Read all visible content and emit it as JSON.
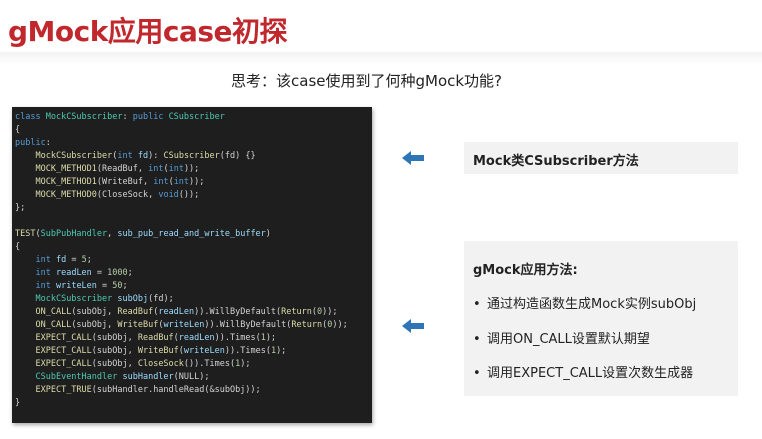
{
  "slide": {
    "title": "gMock应用case初探",
    "question": "思考：该case使用到了何种gMock功能?"
  },
  "code": {
    "lines": [
      [
        [
          "kw",
          "class "
        ],
        [
          "ty",
          "MockCSubscriber"
        ],
        [
          "t",
          ": "
        ],
        [
          "kw",
          "public "
        ],
        [
          "ty",
          "CSubscriber"
        ]
      ],
      [
        [
          "t",
          "{"
        ]
      ],
      [
        [
          "kw",
          "public"
        ],
        [
          "t",
          ":"
        ]
      ],
      [
        [
          "t",
          "    "
        ],
        [
          "fn",
          "MockCSubscriber"
        ],
        [
          "t",
          "("
        ],
        [
          "kw",
          "int "
        ],
        [
          "vr",
          "fd"
        ],
        [
          "t",
          "): "
        ],
        [
          "fn",
          "CSubscriber"
        ],
        [
          "t",
          "(fd) {}"
        ]
      ],
      [
        [
          "t",
          "    "
        ],
        [
          "fn",
          "MOCK_METHOD1"
        ],
        [
          "t",
          "(ReadBuf, "
        ],
        [
          "kw",
          "int"
        ],
        [
          "t",
          "("
        ],
        [
          "kw",
          "int"
        ],
        [
          "t",
          "));"
        ]
      ],
      [
        [
          "t",
          "    "
        ],
        [
          "fn",
          "MOCK_METHOD1"
        ],
        [
          "t",
          "(WriteBuf, "
        ],
        [
          "kw",
          "int"
        ],
        [
          "t",
          "("
        ],
        [
          "kw",
          "int"
        ],
        [
          "t",
          "));"
        ]
      ],
      [
        [
          "t",
          "    "
        ],
        [
          "fn",
          "MOCK_METHOD0"
        ],
        [
          "t",
          "(CloseSock, "
        ],
        [
          "kw",
          "void"
        ],
        [
          "t",
          "());"
        ]
      ],
      [
        [
          "t",
          "};"
        ]
      ],
      [
        [
          "t",
          ""
        ]
      ],
      [
        [
          "fn",
          "TEST"
        ],
        [
          "t",
          "("
        ],
        [
          "ty",
          "SubPubHandler"
        ],
        [
          "t",
          ", "
        ],
        [
          "vr",
          "sub_pub_read_and_write_buffer"
        ],
        [
          "t",
          ")"
        ]
      ],
      [
        [
          "t",
          "{"
        ]
      ],
      [
        [
          "t",
          "    "
        ],
        [
          "kw",
          "int "
        ],
        [
          "vr",
          "fd"
        ],
        [
          "t",
          " = "
        ],
        [
          "nm",
          "5"
        ],
        [
          "t",
          ";"
        ]
      ],
      [
        [
          "t",
          "    "
        ],
        [
          "kw",
          "int "
        ],
        [
          "vr",
          "readLen"
        ],
        [
          "t",
          " = "
        ],
        [
          "nm",
          "1000"
        ],
        [
          "t",
          ";"
        ]
      ],
      [
        [
          "t",
          "    "
        ],
        [
          "kw",
          "int "
        ],
        [
          "vr",
          "writeLen"
        ],
        [
          "t",
          " = "
        ],
        [
          "nm",
          "50"
        ],
        [
          "t",
          ";"
        ]
      ],
      [
        [
          "t",
          "    "
        ],
        [
          "ty",
          "MockCSubscriber "
        ],
        [
          "vr",
          "subObj"
        ],
        [
          "t",
          "(fd);"
        ]
      ],
      [
        [
          "t",
          "    "
        ],
        [
          "fn",
          "ON_CALL"
        ],
        [
          "t",
          "(subObj, "
        ],
        [
          "fn",
          "ReadBuf"
        ],
        [
          "t",
          "("
        ],
        [
          "vr",
          "readLen"
        ],
        [
          "t",
          ")).WillByDefault("
        ],
        [
          "fn",
          "Return"
        ],
        [
          "t",
          "("
        ],
        [
          "nm",
          "0"
        ],
        [
          "t",
          "));"
        ]
      ],
      [
        [
          "t",
          "    "
        ],
        [
          "fn",
          "ON_CALL"
        ],
        [
          "t",
          "(subObj, "
        ],
        [
          "fn",
          "WriteBuf"
        ],
        [
          "t",
          "("
        ],
        [
          "vr",
          "writeLen"
        ],
        [
          "t",
          ")).WillByDefault("
        ],
        [
          "fn",
          "Return"
        ],
        [
          "t",
          "("
        ],
        [
          "nm",
          "0"
        ],
        [
          "t",
          "));"
        ]
      ],
      [
        [
          "t",
          "    "
        ],
        [
          "fn",
          "EXPECT_CALL"
        ],
        [
          "t",
          "(subObj, "
        ],
        [
          "fn",
          "ReadBuf"
        ],
        [
          "t",
          "("
        ],
        [
          "vr",
          "readLen"
        ],
        [
          "t",
          ")).Times("
        ],
        [
          "nm",
          "1"
        ],
        [
          "t",
          ");"
        ]
      ],
      [
        [
          "t",
          "    "
        ],
        [
          "fn",
          "EXPECT_CALL"
        ],
        [
          "t",
          "(subObj, "
        ],
        [
          "fn",
          "WriteBuf"
        ],
        [
          "t",
          "("
        ],
        [
          "vr",
          "writeLen"
        ],
        [
          "t",
          ")).Times("
        ],
        [
          "nm",
          "1"
        ],
        [
          "t",
          ");"
        ]
      ],
      [
        [
          "t",
          "    "
        ],
        [
          "fn",
          "EXPECT_CALL"
        ],
        [
          "t",
          "(subObj, "
        ],
        [
          "fn",
          "CloseSock"
        ],
        [
          "t",
          "()).Times("
        ],
        [
          "nm",
          "1"
        ],
        [
          "t",
          ");"
        ]
      ],
      [
        [
          "t",
          "    "
        ],
        [
          "ty",
          "CSubEventHandler "
        ],
        [
          "vr",
          "subHandler"
        ],
        [
          "t",
          "(NULL);"
        ]
      ],
      [
        [
          "t",
          "    "
        ],
        [
          "fn",
          "EXPECT_TRUE"
        ],
        [
          "t",
          "(subHandler.handleRead(&subObj));"
        ]
      ],
      [
        [
          "t",
          "}"
        ]
      ]
    ]
  },
  "callout_mock": {
    "label": "Mock类CSubscriber方法"
  },
  "callout_usage": {
    "heading": "gMock应用方法:",
    "bullets": [
      "通过构造函数生成Mock实例subObj",
      "调用ON_CALL设置默认期望",
      "调用EXPECT_CALL设置次数生成器"
    ]
  },
  "bullet_symbol": "•",
  "colors": {
    "title": "#c0282d",
    "arrow": "#2e75b6",
    "code_bg": "#1e1e1e",
    "callout_bg": "#f2f2f2"
  },
  "icons": {
    "arrow": "arrow-left-icon"
  }
}
